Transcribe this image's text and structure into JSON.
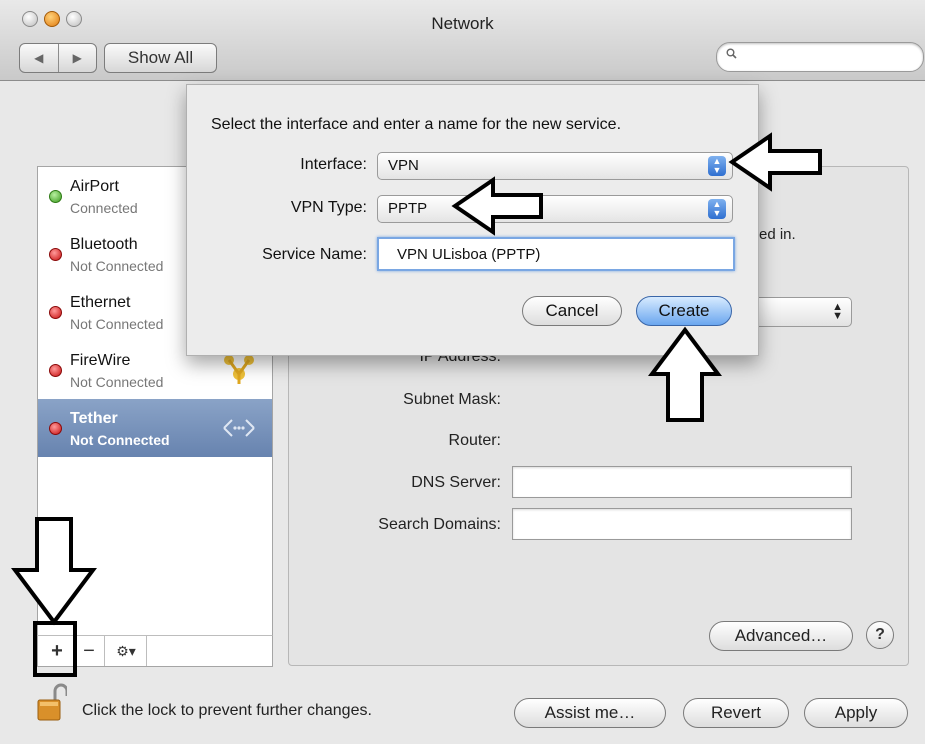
{
  "window": {
    "title": "Network",
    "show_all_label": "Show All",
    "search_placeholder": "",
    "icons": [
      "back-arrow-icon",
      "forward-arrow-icon",
      "search-icon"
    ]
  },
  "sidebar": {
    "services": [
      {
        "name": "AirPort",
        "status": "Connected",
        "status_color": "#3a9a1c",
        "icon": "wifi-icon",
        "selected": false
      },
      {
        "name": "Bluetooth",
        "status": "Not Connected",
        "status_color": "#c81010",
        "icon": "bluetooth-icon",
        "selected": false
      },
      {
        "name": "Ethernet",
        "status": "Not Connected",
        "status_color": "#c81010",
        "icon": "ethernet-icon",
        "selected": false
      },
      {
        "name": "FireWire",
        "status": "Not Connected",
        "status_color": "#c81010",
        "icon": "firewire-icon",
        "selected": false
      },
      {
        "name": "Tether",
        "status": "Not Connected",
        "status_color": "#c81010",
        "icon": "tether-icon",
        "selected": true
      }
    ],
    "toolbar": {
      "add_label": "+",
      "remove_label": "−",
      "action_label": "⚙▾"
    }
  },
  "detail": {
    "status_partial": "ed in.",
    "fields": {
      "ip_address_label": "IP Address:",
      "subnet_mask_label": "Subnet Mask:",
      "router_label": "Router:",
      "dns_server_label": "DNS Server:",
      "search_domains_label": "Search Domains:"
    },
    "advanced_label": "Advanced…",
    "help_label": "?"
  },
  "footer": {
    "lock_text": "Click the lock to prevent further changes.",
    "assist_label": "Assist me…",
    "revert_label": "Revert",
    "apply_label": "Apply"
  },
  "sheet": {
    "prompt": "Select the interface and enter a name for the new service.",
    "interface_label": "Interface:",
    "interface_value": "VPN",
    "vpn_type_label": "VPN Type:",
    "vpn_type_value": "PPTP",
    "service_name_label": "Service Name:",
    "service_name_value": "VPN ULisboa (PPTP)",
    "cancel_label": "Cancel",
    "create_label": "Create"
  },
  "colors": {
    "selection": "#6783af",
    "create_button": "#6aa6ef",
    "focus_ring": "#7aa7e3"
  }
}
